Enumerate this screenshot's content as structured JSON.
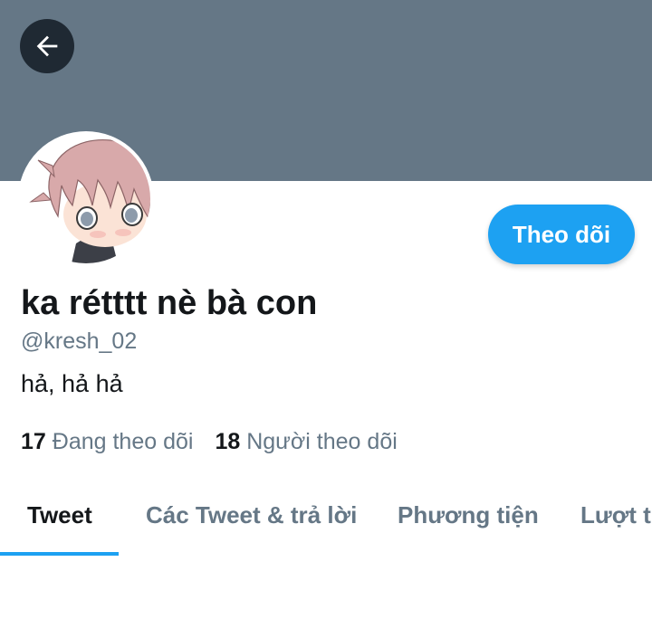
{
  "header": {
    "back_icon": "arrow-left-icon",
    "banner_color": "#657786"
  },
  "profile": {
    "display_name": "ka rétttt nè bà con",
    "handle": "@kresh_02",
    "bio": "hả, hả hả",
    "follow_label": "Theo dõi",
    "avatar": "anime-character-avatar"
  },
  "stats": {
    "following_count": "17",
    "following_label": "Đang theo dõi",
    "followers_count": "18",
    "followers_label": "Người theo dõi"
  },
  "tabs": [
    {
      "label": "Tweet",
      "active": true
    },
    {
      "label": "Các Tweet & trả lời",
      "active": false
    },
    {
      "label": "Phương tiện",
      "active": false
    },
    {
      "label": "Lượt th",
      "active": false
    }
  ],
  "colors": {
    "accent": "#1da1f2",
    "text_primary": "#14171a",
    "text_secondary": "#657786"
  }
}
